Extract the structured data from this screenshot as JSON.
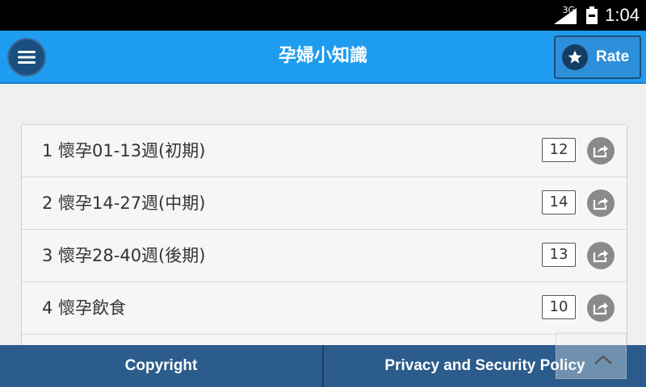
{
  "status": {
    "network": "3G",
    "time": "1:04"
  },
  "header": {
    "title": "孕婦小知識",
    "rate_label": "Rate"
  },
  "list": [
    {
      "label": "1 懷孕01-13週(初期)",
      "count": "12"
    },
    {
      "label": "2 懷孕14-27週(中期)",
      "count": "14"
    },
    {
      "label": "3 懷孕28-40週(後期)",
      "count": "13"
    },
    {
      "label": "4 懷孕飲食",
      "count": "10"
    }
  ],
  "footer": {
    "copyright": "Copyright",
    "privacy": "Privacy and Security Policy"
  },
  "icons": {
    "menu": "hamburger-icon",
    "rate": "star-icon",
    "share": "share-icon",
    "scroll": "chevron-up-icon"
  },
  "colors": {
    "header": "#1e9cf0",
    "footer": "#2b5c8c",
    "rate_button": "#2d8fda"
  }
}
